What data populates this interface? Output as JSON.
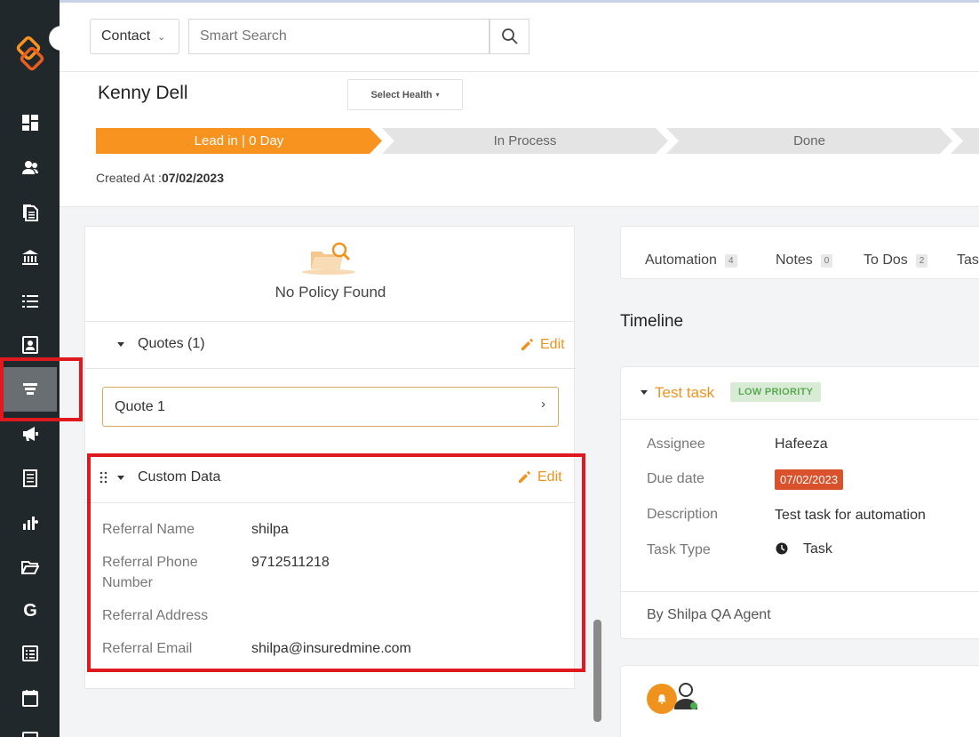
{
  "header": {
    "module_select": "Contact",
    "search_placeholder": "Smart Search",
    "contact_name": "Kenny Dell",
    "select_health": "Select Health",
    "stages": [
      "Lead in | 0 Day",
      "In Process",
      "Done"
    ],
    "created_label": "Created At :",
    "created_date": "07/02/2023"
  },
  "left": {
    "no_policy": "No Policy Found",
    "quotes_title": "Quotes (1)",
    "edit_label": "Edit",
    "quote_item": "Quote 1",
    "custom_title": "Custom Data",
    "custom_fields": [
      {
        "label": "Referral Name",
        "value": "shilpa"
      },
      {
        "label": "Referral Phone Number",
        "value": "9712511218"
      },
      {
        "label": "Referral Address",
        "value": ""
      },
      {
        "label": "Referral Email",
        "value": "shilpa@insuredmine.com"
      }
    ]
  },
  "right": {
    "tabs": [
      {
        "label": "Automation",
        "count": "4"
      },
      {
        "label": "Notes",
        "count": "0"
      },
      {
        "label": "To Dos",
        "count": "2"
      },
      {
        "label": "Tas",
        "count": ""
      }
    ],
    "timeline_title": "Timeline",
    "task": {
      "title": "Test task",
      "priority": "LOW PRIORITY",
      "assignee_label": "Assignee",
      "assignee": "Hafeeza",
      "due_label": "Due date",
      "due": "07/02/2023",
      "description_label": "Description",
      "description": "Test task for automation",
      "type_label": "Task Type",
      "type": "Task",
      "by": "By Shilpa QA Agent"
    }
  },
  "colors": {
    "accent": "#f8931f",
    "sidebar": "#21282c",
    "highlight": "#e0191e",
    "due_badge": "#d9522c"
  },
  "sidebar_icons": [
    "dashboard-icon",
    "contacts-icon",
    "documents-icon",
    "bank-icon",
    "list-icon",
    "contact-card-icon",
    "pipeline-funnel-icon",
    "megaphone-icon",
    "ledger-icon",
    "analytics-icon",
    "folder-icon",
    "google-icon",
    "sheet-icon",
    "calendar-icon"
  ]
}
